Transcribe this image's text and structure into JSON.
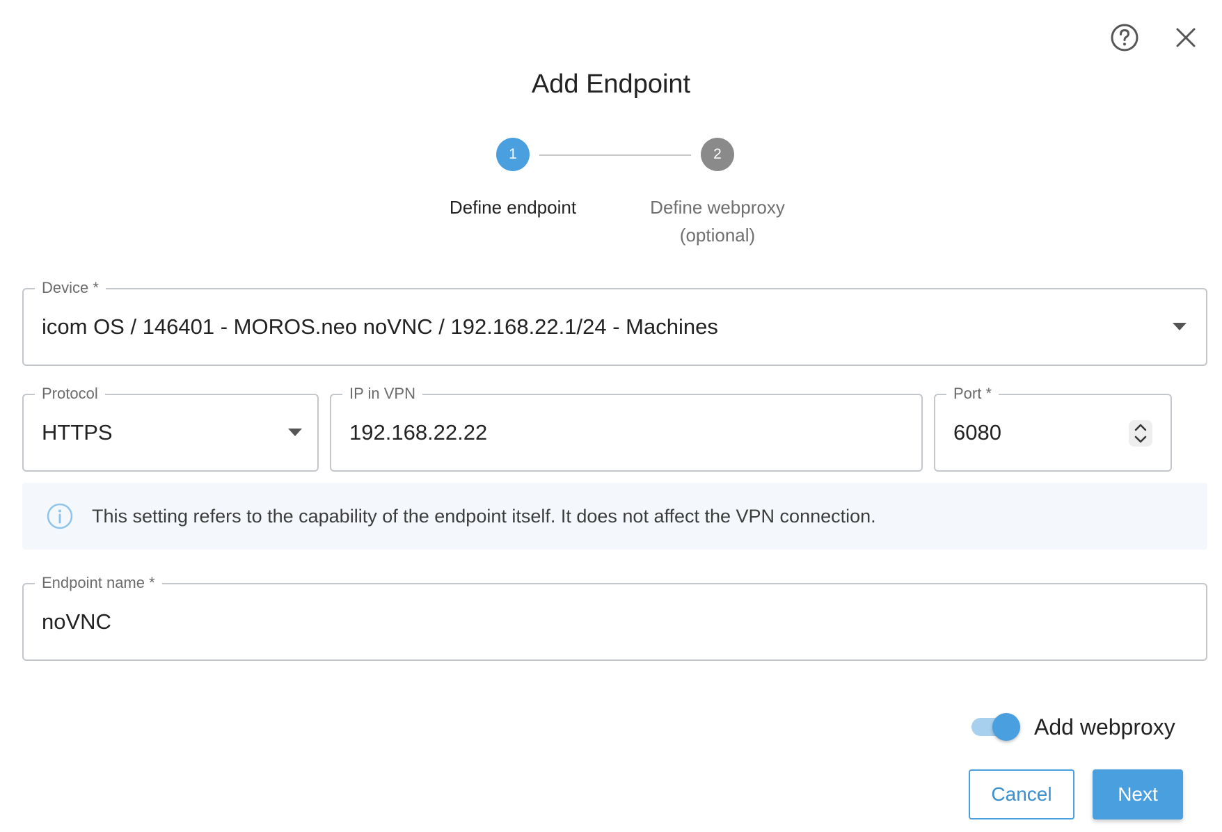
{
  "dialog": {
    "title": "Add Endpoint",
    "help_icon": "help-circle-icon",
    "close_icon": "close-icon"
  },
  "stepper": {
    "steps": [
      {
        "number": "1",
        "label": "Define endpoint",
        "state": "active",
        "color": "#4a9fde"
      },
      {
        "number": "2",
        "label": "Define webproxy",
        "sublabel": "(optional)",
        "state": "inactive",
        "color": "#8a8a8a"
      }
    ]
  },
  "form": {
    "device": {
      "label": "Device",
      "required_mark": "*",
      "value": "icom OS / 146401 - MOROS.neo noVNC / 192.168.22.1/24 - Machines"
    },
    "protocol": {
      "label": "Protocol",
      "value": "HTTPS"
    },
    "ip_in_vpn": {
      "label": "IP in VPN",
      "value": "192.168.22.22"
    },
    "port": {
      "label": "Port",
      "required_mark": "*",
      "value": "6080"
    },
    "info": {
      "icon": "info-icon",
      "text": "This setting refers to the capability of the endpoint itself. It does not affect the VPN connection."
    },
    "endpoint_name": {
      "label": "Endpoint name",
      "required_mark": "*",
      "value": "noVNC"
    },
    "add_webproxy": {
      "label": "Add webproxy",
      "checked": true
    }
  },
  "actions": {
    "cancel_label": "Cancel",
    "next_label": "Next"
  },
  "colors": {
    "primary": "#4a9fde",
    "inactive_step": "#8a8a8a",
    "info_background": "#f4f8fc",
    "border": "#c3c6ca"
  }
}
